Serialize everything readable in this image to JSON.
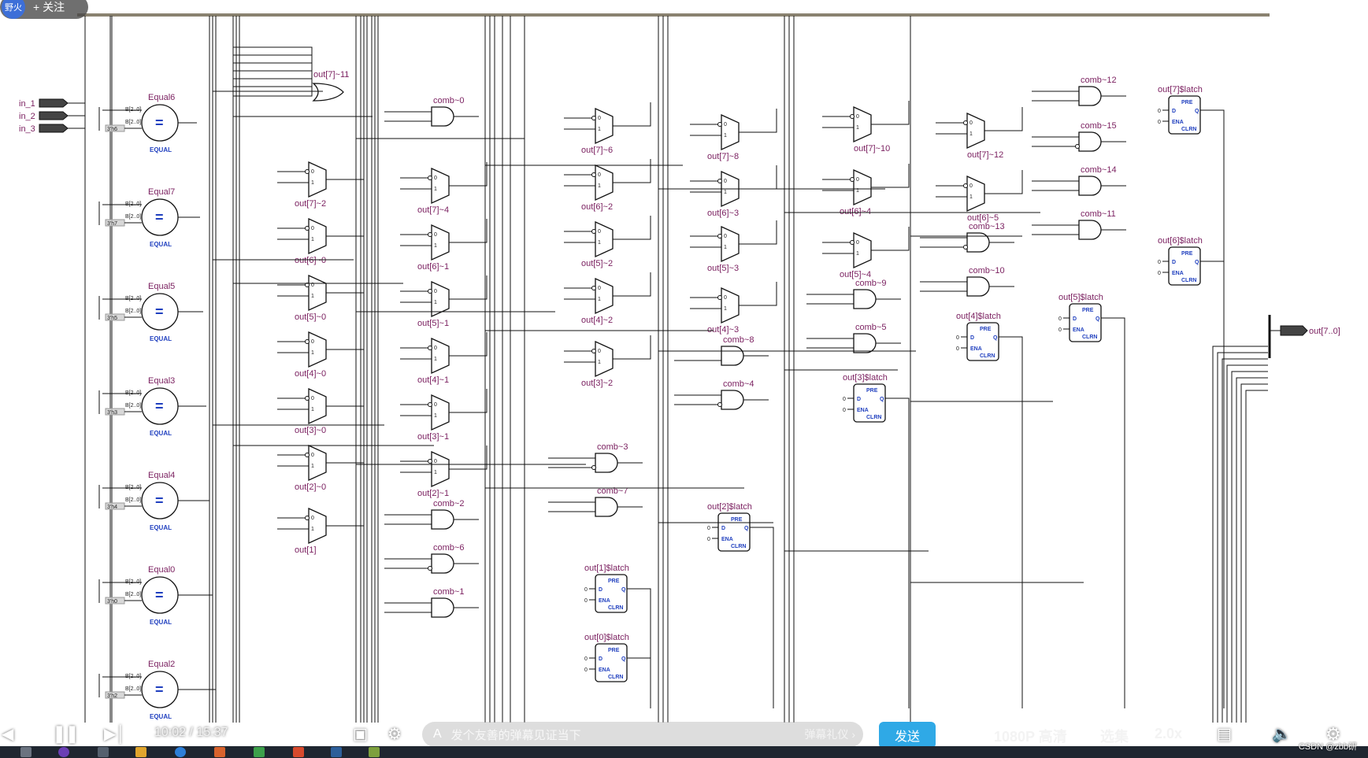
{
  "player": {
    "uploader_badge": "野火",
    "follow_label": "+ 关注",
    "time_current": "10:02",
    "time_separator": "/",
    "time_total": "15:37",
    "danmaku_placeholder": "发个友善的弹幕见证当下",
    "gift_label": "弹幕礼仪 ›",
    "send_label": "发送",
    "quality_label": "1080P 高清",
    "episodes_label": "选集",
    "speed_label": "2.0x",
    "watermark": "CSDN @zbb研"
  },
  "inputs": [
    "in_1",
    "in_2",
    "in_3"
  ],
  "output_port": "out[7..0]",
  "comparators": [
    {
      "name": "Equal6",
      "const": "3'h6",
      "bus": "B[2..0]",
      "sym": "=",
      "sub": "EQUAL"
    },
    {
      "name": "Equal7",
      "const": "3'h7",
      "bus": "B[2..0]",
      "sym": "=",
      "sub": "EQUAL"
    },
    {
      "name": "Equal5",
      "const": "3'h5",
      "bus": "B[2..0]",
      "sym": "=",
      "sub": "EQUAL"
    },
    {
      "name": "Equal3",
      "const": "3'h3",
      "bus": "B[2..0]",
      "sym": "=",
      "sub": "EQUAL"
    },
    {
      "name": "Equal4",
      "const": "3'h4",
      "bus": "B[2..0]",
      "sym": "=",
      "sub": "EQUAL"
    },
    {
      "name": "Equal0",
      "const": "3'h0",
      "bus": "B[2..0]",
      "sym": "=",
      "sub": "EQUAL"
    },
    {
      "name": "Equal2",
      "const": "3'h2",
      "bus": "B[2..0]",
      "sym": "=",
      "sub": "EQUAL"
    }
  ],
  "or_gate": "out[7]~11",
  "muxes": [
    "out[7]~2",
    "out[6]~0",
    "out[5]~0",
    "out[4]~0",
    "out[3]~0",
    "out[2]~0",
    "out[1]",
    "out[7]~4",
    "out[6]~1",
    "out[5]~1",
    "out[4]~1",
    "out[3]~1",
    "out[2]~1",
    "out[7]~6",
    "out[6]~2",
    "out[5]~2",
    "out[4]~2",
    "out[3]~2",
    "out[7]~8",
    "out[6]~3",
    "out[5]~3",
    "out[4]~3",
    "out[7]~10",
    "out[6]~4",
    "out[5]~4",
    "out[7]~12",
    "out[6]~5"
  ],
  "and_gates": [
    "comb~0",
    "comb~3",
    "comb~7",
    "comb~2",
    "comb~6",
    "comb~1",
    "comb~8",
    "comb~4",
    "comb~9",
    "comb~5",
    "comb~13",
    "comb~10",
    "comb~12",
    "comb~15",
    "comb~14",
    "comb~11"
  ],
  "latches": [
    "out[7]$latch",
    "out[6]$latch",
    "out[5]$latch",
    "out[4]$latch",
    "out[3]$latch",
    "out[2]$latch",
    "out[1]$latch",
    "out[0]$latch"
  ],
  "latch_pins": {
    "pre": "PRE",
    "d": "D",
    "q": "Q",
    "ena": "ENA",
    "clrn": "CLRN"
  },
  "mux_pins": [
    "0",
    "1"
  ]
}
